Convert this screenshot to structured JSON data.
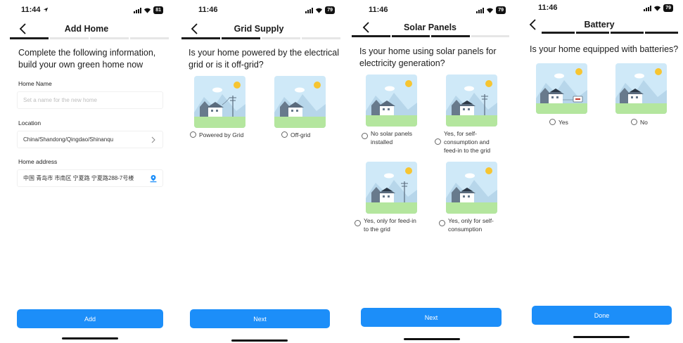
{
  "screens": [
    {
      "status": {
        "time": "11:44",
        "battery": "81"
      },
      "title": "Add Home",
      "heading": "Complete the following information, build your own green home now",
      "fields": [
        {
          "label": "Home Name",
          "placeholder": "Set a name for the new home",
          "value": ""
        },
        {
          "label": "Location",
          "value": "China/Shandong/Qingdao/Shinanqu"
        },
        {
          "label": "Home address",
          "value": "中国 青岛市 市南区 宁夏路 宁夏路288-7号楼"
        }
      ],
      "button": "Add"
    },
    {
      "status": {
        "time": "11:46",
        "battery": "79"
      },
      "title": "Grid Supply",
      "heading": "Is your home powered by the electrical grid or is it off-grid?",
      "options": [
        "Powered by Grid",
        "Off-grid"
      ],
      "button": "Next"
    },
    {
      "status": {
        "time": "11:46",
        "battery": "79"
      },
      "title": "Solar Panels",
      "heading": "Is your home using solar panels for electricity generation?",
      "options": [
        "No solar panels installed",
        "Yes, for self-consumption and feed-in to the grid",
        "Yes, only for feed-in to the grid",
        "Yes, only for self-consumption"
      ],
      "button": "Next"
    },
    {
      "status": {
        "time": "11:46",
        "battery": "79"
      },
      "title": "Battery",
      "heading": "Is your home equipped with batteries?",
      "options": [
        "Yes",
        "No"
      ],
      "button": "Done"
    }
  ],
  "colors": {
    "accent": "#1c8ef9",
    "sky": "#cfe9f8",
    "grass": "#b4e69e",
    "sun": "#f7c531"
  },
  "icons": [
    "back-chevron-icon",
    "chevron-right-icon",
    "location-pin-icon",
    "signal-icon",
    "wifi-icon",
    "battery-icon",
    "location-arrow-icon"
  ]
}
